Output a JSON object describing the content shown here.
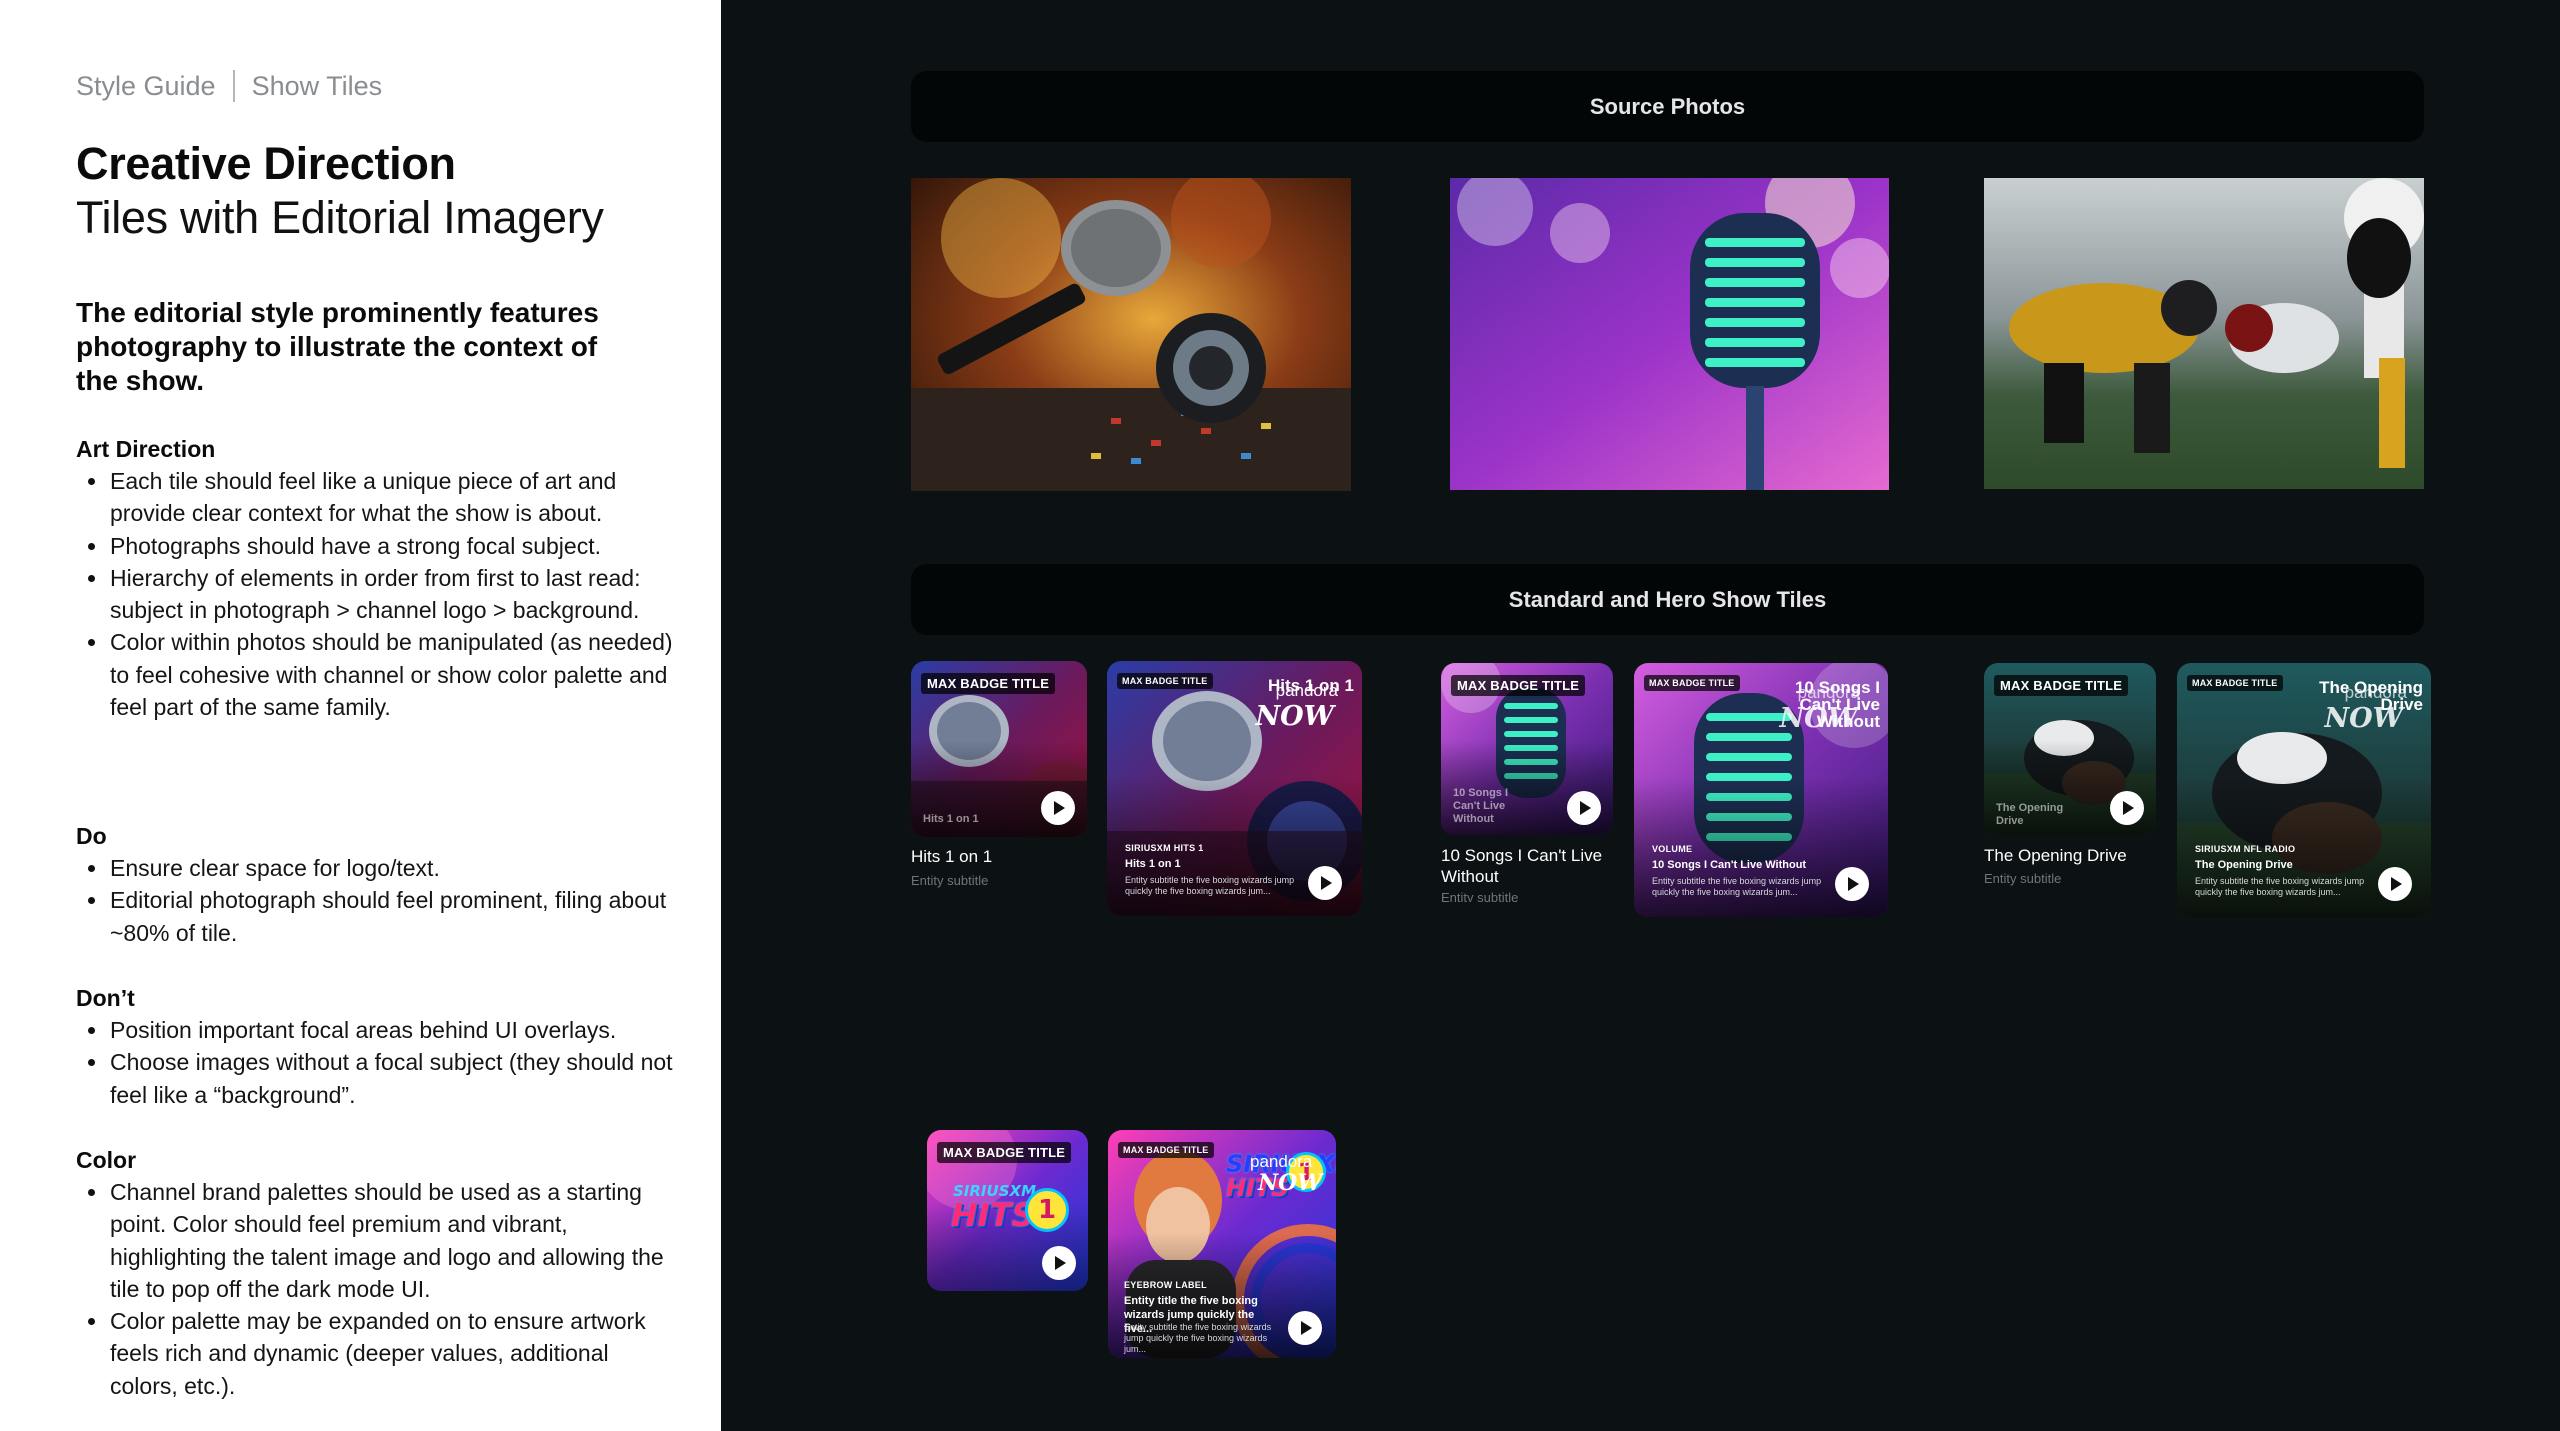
{
  "breadcrumb": {
    "section": "Style Guide",
    "page": "Show Tiles"
  },
  "heading": {
    "title": "Creative Direction",
    "subtitle": "Tiles with Editorial Imagery"
  },
  "lead": "The editorial style prominently features photography to illustrate the context of the show.",
  "sections": {
    "art_direction": {
      "heading": "Art Direction",
      "items": [
        "Each tile should feel like a unique piece of art and provide clear context for what the show is about.",
        "Photographs should have a strong focal subject.",
        "Hierarchy of elements in order from first to last read: subject in photograph > channel logo > background.",
        "Color within photos should be manipulated (as needed) to feel cohesive with channel or show color palette and feel part of the same family."
      ]
    },
    "do": {
      "heading": "Do",
      "items": [
        "Ensure clear space for logo/text.",
        "Editorial photograph should feel prominent, filing about ~80% of tile."
      ]
    },
    "dont": {
      "heading": "Don’t",
      "items": [
        "Position important focal areas behind UI overlays.",
        "Choose images without a focal subject (they should not feel like a “background”."
      ]
    },
    "color": {
      "heading": "Color",
      "items": [
        "Channel brand palettes should be used as a starting point. Color should feel premium and vibrant, highlighting the talent image and logo and allowing the tile to pop off the dark mode UI.",
        "Color palette may be expanded on to ensure artwork feels rich and dynamic (deeper values, additional colors, etc.)."
      ]
    }
  },
  "banners": {
    "source_photos": "Source Photos",
    "tiles": "Standard and Hero Show Tiles"
  },
  "tiles": {
    "badge": "MAX BADGE TITLE",
    "entity_subtitle": "Entity subtitle",
    "hero_desc": "Entity subtitle the five boxing wizards jump quickly the five boxing wizards jum...",
    "hits": {
      "ghost": "Hits 1 on 1",
      "title": "Hits 1 on 1",
      "hero_eyebrow": "SIRIUSXM HITS 1",
      "hero_title": "Hits 1 on 1",
      "logo_top": "Hits 1 on 1",
      "logo_brand": "pandora",
      "logo_now": "NOW"
    },
    "songs": {
      "ghost": "10 Songs I Can't Live Without",
      "title": "10 Songs I Can't Live Without",
      "hero_eyebrow": "VOLUME",
      "hero_title": "10 Songs I Can't Live Without",
      "logo_top": "10 Songs I Can't Live Without",
      "logo_brand": "pandora",
      "logo_now": "NOW"
    },
    "drive": {
      "ghost": "The Opening Drive",
      "title": "The Opening Drive",
      "hero_eyebrow": "SIRIUSXM NFL RADIO",
      "hero_title": "The Opening Drive",
      "logo_top": "The Opening Drive",
      "logo_brand": "pandora",
      "logo_now": "NOW"
    },
    "sxm": {
      "logo_brand": "SIRIUSXM",
      "logo_hits": "HITS",
      "logo_num": "1",
      "hero_eyebrow": "EYEBROW LABEL",
      "hero_title": "Entity title the five boxing wizards jump quickly the five...",
      "hero_logo_brand": "pandora",
      "hero_logo_now": "NOW"
    }
  }
}
